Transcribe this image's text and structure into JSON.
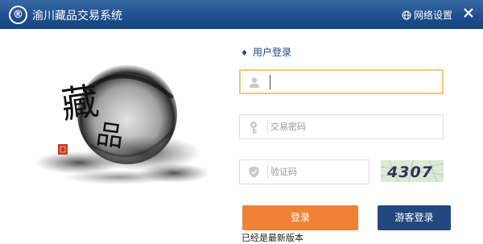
{
  "titlebar": {
    "logo_glyph": "®",
    "title": "渝川藏品交易系统",
    "net_settings_label": "网络设置",
    "close_glyph": "✕"
  },
  "artwork": {
    "char_top": "藏",
    "char_bottom": "品"
  },
  "login": {
    "heading_marker": "♦",
    "heading": "用户登录",
    "username": {
      "value": "",
      "placeholder": ""
    },
    "password": {
      "value": "",
      "placeholder": "交易密码"
    },
    "captcha": {
      "value": "",
      "placeholder": "验证码",
      "code": "4307"
    },
    "login_button": "登录",
    "guest_button": "游客登录",
    "version_text": "已经是最新版本"
  },
  "colors": {
    "titlebar": "#1f4f8d",
    "accent_orange": "#ef8236",
    "accent_navy": "#22487f",
    "focus_border": "#f0c879"
  },
  "icons": [
    "logo-icon",
    "globe-icon",
    "close-icon",
    "user-icon",
    "key-icon",
    "shield-icon"
  ]
}
